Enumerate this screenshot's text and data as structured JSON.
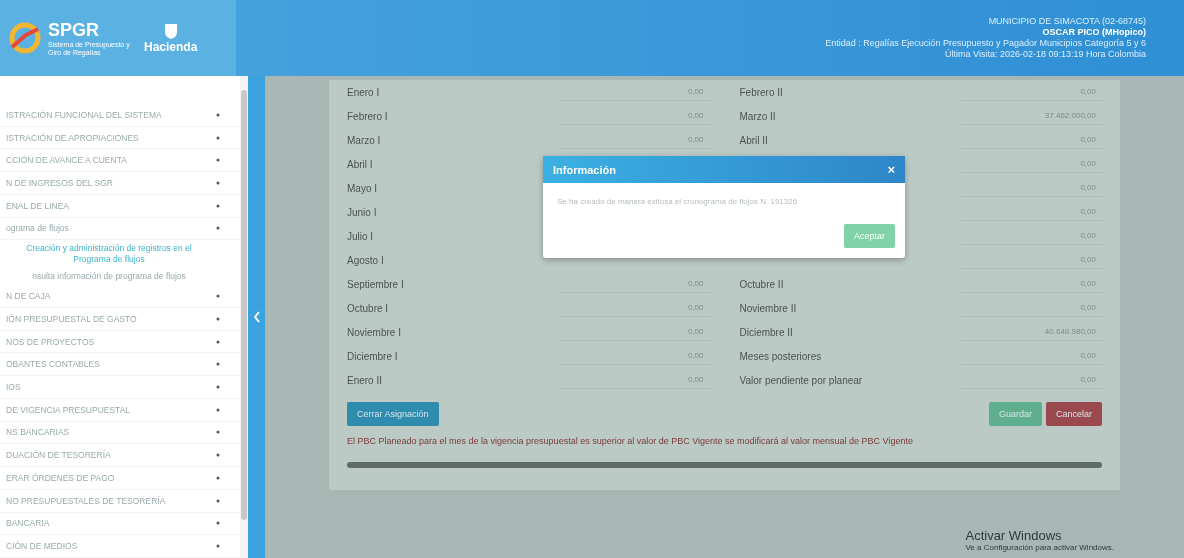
{
  "header": {
    "logo": "SPGR",
    "logo_subtitle": "Sistema de Presupuesto y Giro de Regalías",
    "ministry": "Hacienda",
    "municipality": "MUNICIPIO DE SIMACOTA (02-68745)",
    "user": "OSCAR PICO (MHopico)",
    "entity": "Entidad : Regalías Ejecución Presupuesto y Pagador Municipios Categoría 5 y 6",
    "last_visit": "Última Visita: 2026-02-18 09:13:19 Hora Colombia"
  },
  "sidebar": {
    "items": [
      {
        "label": "ISTRACIÓN FUNCIONAL DEL SISTEMA"
      },
      {
        "label": "ISTRACIÓN DE APROPIACIONES"
      },
      {
        "label": "CCIÓN DE AVANCE A CUENTA"
      },
      {
        "label": "N DE INGRESOS DEL SGR"
      },
      {
        "label": "ENAL DE LINEA"
      },
      {
        "label": "ograma de flujos",
        "children": [
          {
            "label": "Creación y administración de registros en el Programa de flujos",
            "selected": true
          },
          {
            "label": "nsulta información de programa de flujos",
            "selected": false
          }
        ]
      },
      {
        "label": "N DE CAJA"
      },
      {
        "label": "IÓN PRESUPUESTAL DE GASTO"
      },
      {
        "label": "NOS DE PROYECTOS"
      },
      {
        "label": "OBANTES CONTABLES"
      },
      {
        "label": "IOS"
      },
      {
        "label": "DE VIGENCIA PRESUPUESTAL"
      },
      {
        "label": "NS BANCARIAS"
      },
      {
        "label": "DUACIÓN DE TESORERÍA"
      },
      {
        "label": "ERAR ÓRDENES DE PAGO"
      },
      {
        "label": "NO PRESUPUESTALES DE TESORERÍA"
      },
      {
        "label": "BANCARIA"
      },
      {
        "label": "CIÓN DE MEDIOS"
      }
    ]
  },
  "form": {
    "left": [
      {
        "label": "Enero I",
        "value": "0,00"
      },
      {
        "label": "Febrero I",
        "value": "0,00"
      },
      {
        "label": "Marzo I",
        "value": "0,00"
      },
      {
        "label": "Abril I"
      },
      {
        "label": "Mayo I"
      },
      {
        "label": "Junio I"
      },
      {
        "label": "Julio I"
      },
      {
        "label": "Agosto I"
      },
      {
        "label": "Septiembre I",
        "value": "0,00"
      },
      {
        "label": "Octubre I",
        "value": "0,00"
      },
      {
        "label": "Noviembre I",
        "value": "0,00"
      },
      {
        "label": "Diciembre I",
        "value": "0,00"
      },
      {
        "label": "Enero II",
        "value": "0,00"
      }
    ],
    "right": [
      {
        "label": "Febrero II",
        "value": "0,00"
      },
      {
        "label": "Marzo II",
        "value": "37.462.000,00"
      },
      {
        "label": "Abril II",
        "value": "0,00"
      },
      {
        "value": "0,00"
      },
      {
        "value": "0,00"
      },
      {
        "value": "0,00"
      },
      {
        "value": "0,00"
      },
      {
        "value": "0,00"
      },
      {
        "label": "Octubre II",
        "value": "0,00"
      },
      {
        "label": "Noviembre II",
        "value": "0,00"
      },
      {
        "label": "Diciembre II",
        "value": "40.648.980,00"
      },
      {
        "label": "Meses posteriores",
        "value": "0,00"
      },
      {
        "label": "Valor pendiente por planear",
        "value": "0,00"
      }
    ],
    "close_button": "Cerrar Asignación",
    "save_button": "Guardar",
    "cancel_button": "Cancelar",
    "warning": "El PBC Planeado para el mes de la vigencia presupuestal es superior al valor de PBC Vigente se modificará al valor mensual de PBC Vigente"
  },
  "dialog": {
    "title": "Información",
    "close": "×",
    "message": "Se ha creado de manera exitosa el cronograma de flujos N. 191326",
    "button": "Aceptar"
  },
  "os_notice": {
    "title": "Activar Windows",
    "text": "Ve a Configuración para activar Windows."
  }
}
